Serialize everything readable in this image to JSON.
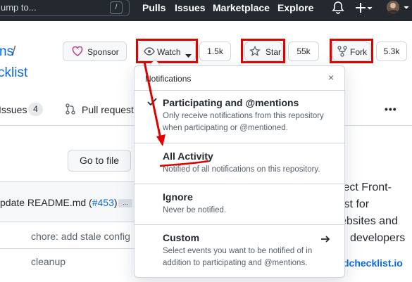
{
  "header": {
    "search_placeholder": "ump to...",
    "slash_key": "/",
    "nav": [
      "Pulls",
      "Issues",
      "Marketplace",
      "Explore"
    ]
  },
  "repo": {
    "owner_fragment": "ns",
    "separator": "/",
    "name_fragment": "cklist"
  },
  "actions": {
    "sponsor_label": "Sponsor",
    "watch_label": "Watch",
    "watch_count": "1.5k",
    "star_label": "Star",
    "star_count": "55k",
    "fork_label": "Fork",
    "fork_count": "5.3k"
  },
  "tabs": {
    "issues_label": "Issues",
    "issues_count": "4",
    "pulls_label": "Pull requests",
    "more": "•••"
  },
  "files": {
    "goto_label": "Go to file",
    "commit_message": "pdate README.md (",
    "commit_link": "#453",
    "commit_close": ")",
    "ellipsis": "...",
    "rows": [
      "chore: add stale config",
      "cleanup"
    ]
  },
  "about": {
    "lines": [
      "fect Front-",
      "ist for",
      "ebsites and",
      "developers"
    ],
    "link": "dchecklist.io"
  },
  "dropdown": {
    "title": "Notifications",
    "close": "×",
    "options": [
      {
        "title": "Participating and @mentions",
        "desc": "Only receive notifications from this repository when participating or @mentioned.",
        "checked": true
      },
      {
        "title": "All Activity",
        "desc": "Notified of all notifications on this repository.",
        "checked": false
      },
      {
        "title": "Ignore",
        "desc": "Never be notified.",
        "checked": false
      },
      {
        "title": "Custom",
        "desc": "Select events you want to be notified of in addition to participating and @mentions.",
        "checked": false
      }
    ]
  },
  "colors": {
    "header_bg": "#24292f",
    "link_blue": "#0969da",
    "annotation_red": "#e00000",
    "sponsor_pink": "#bf3989"
  }
}
